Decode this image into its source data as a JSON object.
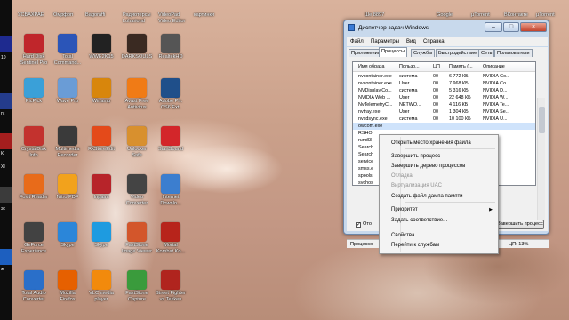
{
  "top_labels": [
    "УСБАХРАЕ",
    "Омрфоп",
    "Bagoraffi",
    "Радиотерсы\nLohariond",
    "VideoPad\nVideo Editor",
    "картинки",
    "Ше 8897",
    "Google",
    "µTorrent",
    "ВКонтакте",
    "µTorrent"
  ],
  "strip_labels": [
    "10",
    "nt",
    "К",
    "XI",
    "эк",
    "ж"
  ],
  "desktop_icons": [
    {
      "label": "Hard Disk\nSentinel Pro",
      "icon": "disk-icon",
      "color": "#c0262b"
    },
    {
      "label": "Total\nCommand...",
      "icon": "floppy-icon",
      "color": "#2b55b8"
    },
    {
      "label": "WWE2K15",
      "icon": "wwe-icon",
      "color": "#222222"
    },
    {
      "label": "DARKSOULS",
      "icon": "darksouls-icon",
      "color": "#3a2a22"
    },
    {
      "label": "RealtekHD",
      "icon": "speaker-icon",
      "color": "#555555"
    },
    {
      "label": "PicPick",
      "icon": "picpick-icon",
      "color": "#3aa0d8"
    },
    {
      "label": "Wave Pro",
      "icon": "wave-icon",
      "color": "#6a9cd6"
    },
    {
      "label": "Winamp",
      "icon": "winamp-icon",
      "color": "#d8860c"
    },
    {
      "label": "Avast Free\nAntivirus",
      "icon": "avast-icon",
      "color": "#f07b16"
    },
    {
      "label": "Adobe Ph.\nCS6 Ext.",
      "icon": "photoshop-icon",
      "color": "#1f4f8a"
    },
    {
      "label": "CrystalDisk\nInfo",
      "icon": "crystaldisk-icon",
      "color": "#c3322e"
    },
    {
      "label": "Multimedia\nRecorder",
      "icon": "film-icon",
      "color": "#3a3a3a"
    },
    {
      "label": "RkStoreEdit",
      "icon": "fire-icon",
      "color": "#e44a1a"
    },
    {
      "label": "Unlocker\nSafe",
      "icon": "chess-icon",
      "color": "#d8902e"
    },
    {
      "label": "StartSound",
      "icon": "power-icon",
      "color": "#d3262a"
    },
    {
      "label": "Foxit Reader",
      "icon": "foxit-icon",
      "color": "#e86b1a"
    },
    {
      "label": "Nitro PDF",
      "icon": "pdf-icon",
      "color": "#f2a21c"
    },
    {
      "label": "Inpaint",
      "icon": "inpaint-icon",
      "color": "#b7242a"
    },
    {
      "label": "Video\nConverter",
      "icon": "reel-icon",
      "color": "#444444"
    },
    {
      "label": "Internet\nDownlo...",
      "icon": "download-icon",
      "color": "#3c7ecf"
    },
    {
      "label": "GeForce\nExperience",
      "icon": "nvidia-icon",
      "color": "#424242"
    },
    {
      "label": "Skype",
      "icon": "play-icon",
      "color": "#2b86d9"
    },
    {
      "label": "Skype",
      "icon": "skype-icon",
      "color": "#1e9be0"
    },
    {
      "label": "FastStone\nImage Viewer",
      "icon": "eye-icon",
      "color": "#d3562b"
    },
    {
      "label": "Mortal\nKombat Ko...",
      "icon": "dragon-icon",
      "color": "#b7241b"
    },
    {
      "label": "Total Audio\nConverter",
      "icon": "audio-icon",
      "color": "#2a6fc9"
    },
    {
      "label": "Mozilla\nFirefox",
      "icon": "firefox-icon",
      "color": "#e66000"
    },
    {
      "label": "VLC media\nplayer",
      "icon": "vlc-icon",
      "color": "#f28a0c"
    },
    {
      "label": "FastStone\nCapture",
      "icon": "capture-icon",
      "color": "#3a9b3c"
    },
    {
      "label": "Street Fighter\nvs Tekken",
      "icon": "fighter-icon",
      "color": "#b0241e"
    }
  ],
  "task_manager": {
    "title": "Диспетчер задач Windows",
    "window_buttons": {
      "minimize": "–",
      "maximize": "□",
      "close": "×"
    },
    "menu": [
      "Файл",
      "Параметры",
      "Вид",
      "Справка"
    ],
    "tabs": [
      "Приложения",
      "Процессы",
      "Службы",
      "Быстродействие",
      "Сеть",
      "Пользователи"
    ],
    "active_tab_index": 1,
    "columns": [
      "Имя образа",
      "Пользо...",
      "ЦП",
      "Память (...",
      "Описание"
    ],
    "rows": [
      {
        "name": "nvcontainer.exe",
        "user": "система",
        "cpu": "00",
        "mem": "6 772 КБ",
        "desc": "NVIDIA Co..."
      },
      {
        "name": "nvcontainer.exe",
        "user": "User",
        "cpu": "00",
        "mem": "7 968 КБ",
        "desc": "NVIDIA Co..."
      },
      {
        "name": "NVDisplay.Co...",
        "user": "система",
        "cpu": "00",
        "mem": "5 316 КБ",
        "desc": "NVIDIA D..."
      },
      {
        "name": "NVIDIA Web ...",
        "user": "User",
        "cpu": "00",
        "mem": "22 648 КБ",
        "desc": "NVIDIA W..."
      },
      {
        "name": "NvTelemetryC...",
        "user": "NETWO...",
        "cpu": "00",
        "mem": "4 116 КБ",
        "desc": "NVIDIA Te..."
      },
      {
        "name": "nvtray.exe",
        "user": "User",
        "cpu": "00",
        "mem": "1 304 КБ",
        "desc": "NVIDIA Se..."
      },
      {
        "name": "nvxdsync.exe",
        "user": "система",
        "cpu": "00",
        "mem": "10 100 КБ",
        "desc": "NVIDIA U..."
      },
      {
        "name": "owcom.exe",
        "user": "",
        "cpu": "",
        "mem": "",
        "desc": ""
      },
      {
        "name": "RSHO",
        "user": "",
        "cpu": "",
        "mem": "",
        "desc": ""
      },
      {
        "name": "rundl3",
        "user": "",
        "cpu": "",
        "mem": "",
        "desc": ""
      },
      {
        "name": "Search",
        "user": "",
        "cpu": "",
        "mem": "",
        "desc": ""
      },
      {
        "name": "Search",
        "user": "",
        "cpu": "",
        "mem": "",
        "desc": ""
      },
      {
        "name": "service",
        "user": "",
        "cpu": "",
        "mem": "",
        "desc": ""
      },
      {
        "name": "smss.e",
        "user": "",
        "cpu": "",
        "mem": "",
        "desc": ""
      },
      {
        "name": "spools",
        "user": "",
        "cpu": "",
        "mem": "",
        "desc": ""
      },
      {
        "name": "svchos",
        "user": "",
        "cpu": "",
        "mem": "",
        "desc": ""
      }
    ],
    "show_all_checkbox": {
      "checked": true,
      "label": "Ото"
    },
    "end_process_button": "Завершить процесс",
    "status": {
      "processes": "Процессо",
      "cpu": "ЦП: 13%"
    }
  },
  "context_menu": {
    "items": [
      {
        "label": "Открыть место хранения файла",
        "enabled": true
      },
      {
        "label": "Завершить процесс",
        "enabled": true
      },
      {
        "label": "Завершить дерево процессов",
        "enabled": true
      },
      {
        "label": "Отладка",
        "enabled": false
      },
      {
        "label": "Виртуализация UAC",
        "enabled": false
      },
      {
        "label": "Создать файл дампа памяти",
        "enabled": true
      },
      {
        "label": "Приоритет",
        "enabled": true,
        "submenu": true
      },
      {
        "label": "Задать соответствие...",
        "enabled": true
      },
      {
        "label": "Свойства",
        "enabled": true
      },
      {
        "label": "Перейти к службам",
        "enabled": true
      }
    ],
    "submenu_arrow": "▶"
  }
}
